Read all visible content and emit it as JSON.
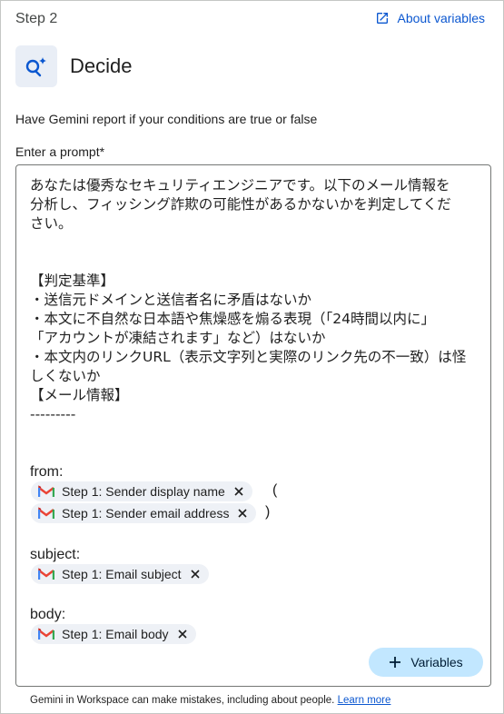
{
  "header": {
    "step_label": "Step 2",
    "about_link": "About variables"
  },
  "title": "Decide",
  "description": "Have Gemini report if your conditions are true or false",
  "prompt": {
    "label": "Enter a prompt*",
    "text": "あなたは優秀なセキュリティエンジニアです。以下のメール情報を\n分析し、フィッシング詐欺の可能性があるかないかを判定してくだ\nさい。\n\n\n【判定基準】\n・送信元ドメインと送信者名に矛盾はないか\n・本文に不自然な日本語や焦燥感を煽る表現（「24時間以内に」\n「アカウントが凍結されます」など）はないか\n・本文内のリンクURL（表示文字列と実際のリンク先の不一致）は怪\nしくないか\n【メール情報】\n---------",
    "from_label": "from:",
    "subject_label": "subject:",
    "body_label": "body:",
    "open_paren": "(",
    "close_paren": ")",
    "chips": {
      "sender_name": "Step 1: Sender display name",
      "sender_email": "Step 1: Sender email address",
      "subject": "Step 1: Email subject",
      "body": "Step 1: Email body"
    },
    "variables_button": "Variables"
  },
  "footer": {
    "text": "Gemini in Workspace can make mistakes, including about people.",
    "link": "Learn more"
  },
  "colors": {
    "accent": "#0b57d0",
    "chip_bg": "#eef1f6",
    "button_bg": "#c2e7ff"
  },
  "icons": {
    "about": "open-in-new-icon",
    "gemini": "gemini-sparkle-icon",
    "chip": "gmail-icon",
    "remove": "close-icon",
    "add": "plus-icon"
  }
}
